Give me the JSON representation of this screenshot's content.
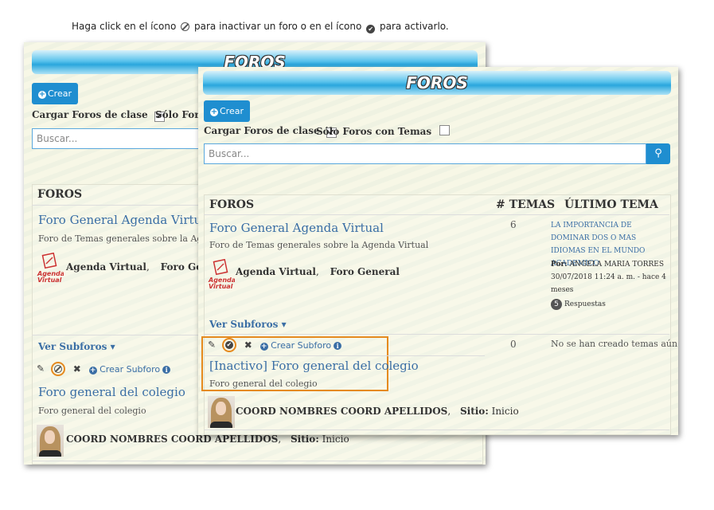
{
  "instruction": {
    "before": "Haga click en el ícono",
    "middle": "para inactivar un foro o en el ícono",
    "after": "para activarlo."
  },
  "back_panel": {
    "banner": "FOROS",
    "create_label": "Crear",
    "load_class_forums": "Cargar Foros de clase",
    "load_class_checked": "✔",
    "only_with_topics": "Sólo Foros",
    "search_placeholder": "Buscar...",
    "col_forums": "FOROS",
    "forum1": {
      "title": "Foro General Agenda Virtual",
      "desc": "Foro de Temas generales sobre la Agenda",
      "author": "Agenda Virtual",
      "site": "Foro Gener"
    },
    "see_subforums": "Ver Subforos",
    "create_subforum": "Crear Subforo",
    "forum2": {
      "title": "Foro general del colegio",
      "desc": "Foro general del colegio",
      "author": "COORD NOMBRES COORD APELLIDOS",
      "site_label": "Sitio:",
      "site": "Inicio"
    }
  },
  "front_panel": {
    "banner": "FOROS",
    "create_label": "Crear",
    "load_class_forums": "Cargar Foros de clase",
    "load_class_checked": "✔",
    "only_with_topics": "Sólo Foros con Temas",
    "search_placeholder": "Buscar...",
    "col_forums": "FOROS",
    "col_topics": "# TEMAS",
    "col_last": "ÚLTIMO TEMA",
    "forum1": {
      "title": "Foro General Agenda Virtual",
      "desc": "Foro de Temas generales sobre la Agenda Virtual",
      "author": "Agenda Virtual",
      "site": "Foro General",
      "topics": "6",
      "last_title": "LA IMPORTANCIA DE DOMINAR DOS O MAS IDIOMAS EN EL MUNDO ACADEMICO",
      "last_by_label": "Por:",
      "last_by": "ANGELA MARIA TORRES",
      "last_date": "30/07/2018 11:24 a. m. - hace 4 meses",
      "replies_count": "5",
      "replies_label": "Respuestas"
    },
    "see_subforums": "Ver Subforos",
    "create_subforum": "Crear Subforo",
    "forum2": {
      "title": "[Inactivo] Foro general del colegio",
      "desc": "Foro general del colegio",
      "author": "COORD NOMBRES COORD APELLIDOS",
      "site_label": "Sitio:",
      "site": "Inicio",
      "topics": "0",
      "no_topics": "No se han creado temas aún"
    }
  },
  "logo_text": "Agenda Virtual",
  "colors": {
    "accent": "#1f8ed0",
    "highlight": "#e58a1f",
    "link": "#3a6ea5"
  }
}
